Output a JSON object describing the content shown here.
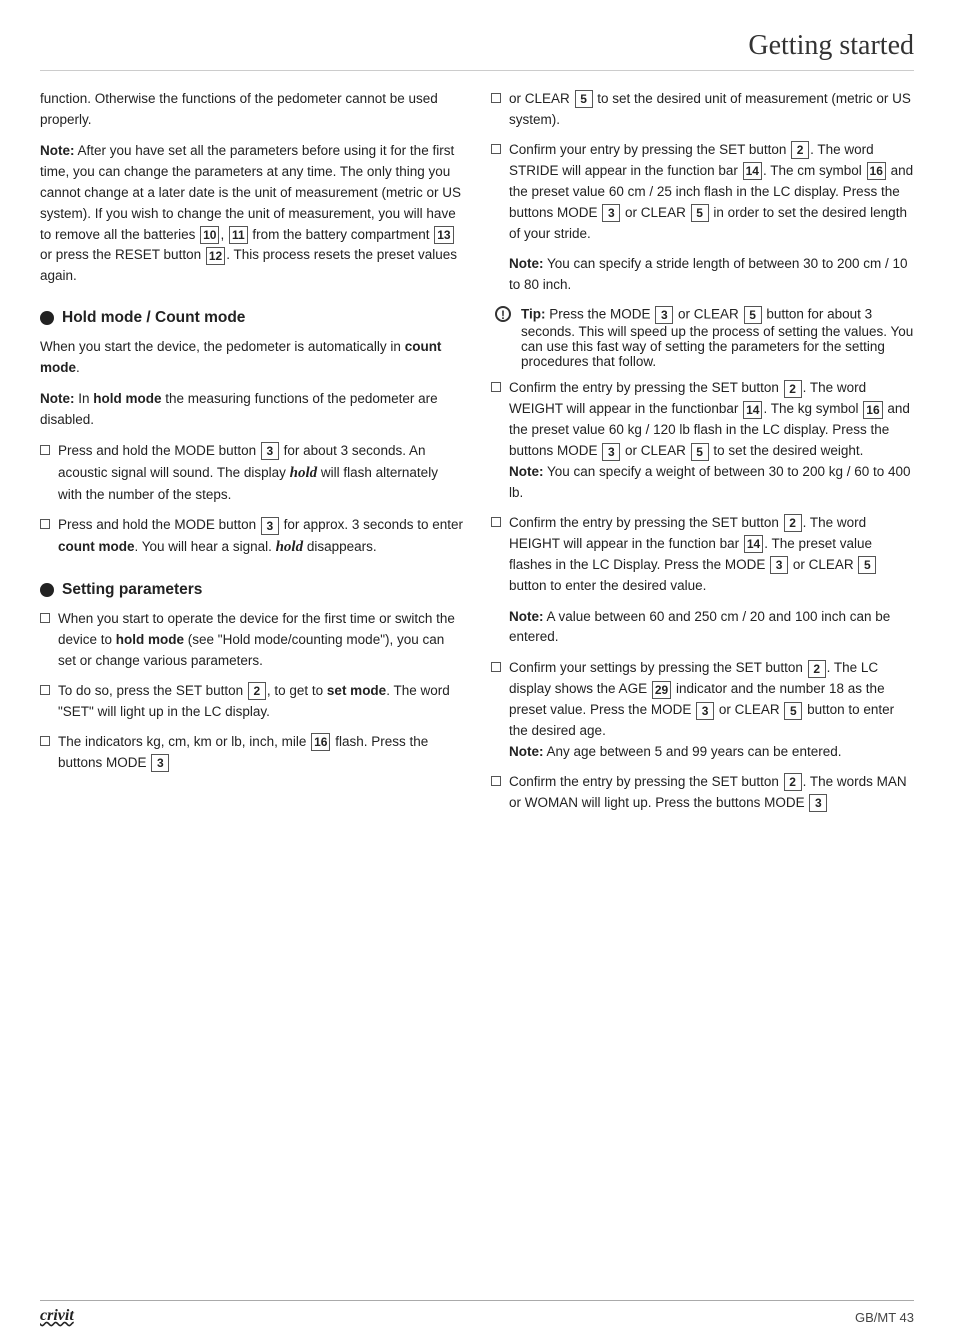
{
  "header": {
    "title": "Getting started"
  },
  "footer": {
    "brand": "crivit",
    "page": "GB/MT   43"
  },
  "left_col": {
    "intro_paragraphs": [
      "function. Otherwise the functions of the pedometer cannot be used properly.",
      "Note: After you have set all the parameters before using it for the first time, you can change the parameters at any time. The only thing you cannot change at a later date is the unit of measurement (metric or US system). If you wish to change the unit of measurement, you will have to remove all the batteries [10], [11] from the battery compartment [13] or press the RESET button [12]. This process resets the preset values again."
    ],
    "hold_mode_section": {
      "heading": "Hold mode / Count mode",
      "intro": "When you start the device, the pedometer is automatically in count mode.",
      "note": "Note: In hold mode the measuring functions of the pedometer are disabled.",
      "items": [
        "Press and hold the MODE button [3] for about 3 seconds. An acoustic signal will sound. The display hold will flash alternately with the number of the steps.",
        "Press and hold the MODE button [3] for approx. 3 seconds to enter count mode. You will hear a signal. hold disappears."
      ]
    },
    "setting_params_section": {
      "heading": "Setting parameters",
      "items": [
        "When you start to operate the device for the first time or switch the device to hold mode (see \"Hold mode/counting mode\"), you can set or change various parameters.",
        "To do so, press the SET button [2], to get to set mode. The word \"SET\" will light up in the LC display.",
        "The indicators kg, cm, km or lb, inch, mile [16] flash. Press the buttons MODE [3]"
      ]
    }
  },
  "right_col": {
    "items": [
      {
        "type": "plain",
        "text": "or CLEAR [5] to set the desired unit of measurement (metric or US system)."
      },
      {
        "type": "plain",
        "text": "Confirm your entry by pressing the SET button [2]. The word STRIDE will appear in the function bar [14]. The cm symbol [16] and the preset value 60 cm / 25 inch flash in the LC display. Press the buttons MODE [3] or CLEAR [5] in order to set the desired length of your stride."
      },
      {
        "type": "note",
        "text": "Note: You can specify a stride length of between 30 to 200 cm / 10 to 80 inch."
      },
      {
        "type": "tip",
        "text": "Tip: Press the MODE [3] or CLEAR [5] button for about 3 seconds. This will speed up the process of setting the values. You can use this fast way of setting the parameters for the setting procedures that follow."
      },
      {
        "type": "plain",
        "text": "Confirm the entry by pressing the SET button [2]. The word WEIGHT will appear in the functionbar [14]. The kg symbol [16] and the preset value 60 kg / 120 lb flash in the LC display. Press the buttons MODE [3] or CLEAR [5] to set the desired weight."
      },
      {
        "type": "note",
        "text": "Note: You can specify a weight of between 30 to 200 kg / 60 to 400 lb."
      },
      {
        "type": "plain",
        "text": "Confirm the entry by pressing the SET button [2]. The word HEIGHT will appear in the function bar [14]. The preset value flashes in the LC Display. Press the MODE [3] or CLEAR [5] button to enter the desired value."
      },
      {
        "type": "note",
        "text": "Note: A value between 60 and 250 cm / 20 and 100 inch can be entered."
      },
      {
        "type": "plain",
        "text": "Confirm your settings by pressing the SET button [2]. The LC display shows the AGE [29] indicator and the number 18 as the preset value. Press the MODE [3] or CLEAR [5] button to enter the desired age."
      },
      {
        "type": "note",
        "text": "Note: Any age between 5 and 99 years can be entered."
      },
      {
        "type": "plain",
        "text": "Confirm the entry by pressing the SET button [2]. The words MAN or WOMAN will light up. Press the buttons MODE [3]"
      }
    ]
  }
}
